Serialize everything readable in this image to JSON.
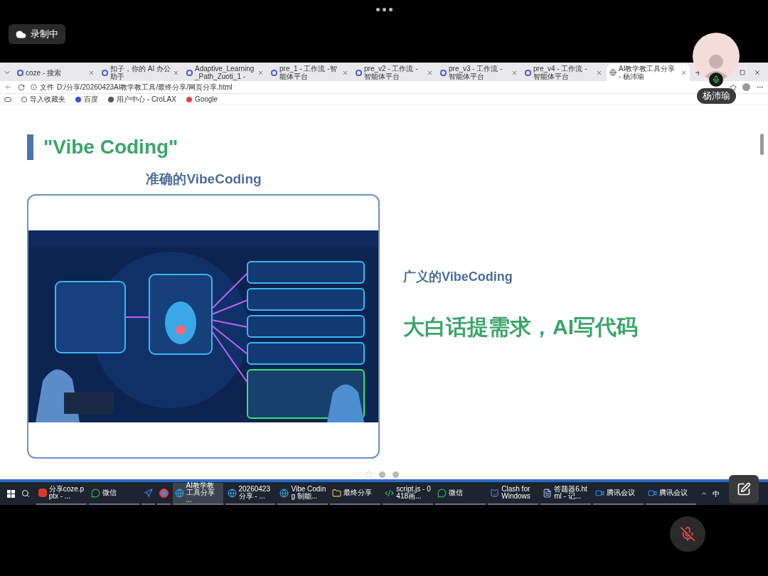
{
  "meeting": {
    "recording_label": "录制中",
    "speaker_name": "杨沛瑜",
    "speaker_mic_on": true,
    "self_muted": true
  },
  "browser": {
    "tabs": [
      {
        "label": "coze - 搜索",
        "selected": false
      },
      {
        "label": "扣子，你的 AI 办公助手",
        "selected": false
      },
      {
        "label": "Adaptive_Learning_Path_Zuoti_1 -",
        "selected": false
      },
      {
        "label": "pre_1 - 工作流 -智能体平台",
        "selected": false
      },
      {
        "label": "pre_v2 - 工作流 -智能体平台",
        "selected": false
      },
      {
        "label": "pre_v3 - 工作流 -智能体平台",
        "selected": false
      },
      {
        "label": "pre_v4 - 工作流 -智能体平台",
        "selected": false
      },
      {
        "label": "AI教学教工具分享 - 杨沛瑜",
        "selected": true
      }
    ],
    "address": {
      "scheme": "文件",
      "url": "D:/分享/20260423AI教学教工具/最终分享/网页分享.html"
    },
    "bookmarks": [
      "导入收藏夹",
      "百度",
      "用户中心 - CroLAX",
      "Google"
    ]
  },
  "slide": {
    "title": "\"Vibe Coding\"",
    "left_heading": "准确的VibeCoding",
    "right_heading": "广义的VibeCoding",
    "right_statement": "大白话提需求，AI写代码",
    "dots": [
      {
        "selected": true
      },
      {
        "selected": false
      },
      {
        "selected": false
      }
    ]
  },
  "taskbar": {
    "apps": [
      {
        "label": "分享coze.pptx - ...",
        "kind": "office",
        "active": false
      },
      {
        "label": "微信",
        "kind": "chat",
        "active": false
      },
      {
        "kind": "arrow",
        "active": false
      },
      {
        "kind": "chrome",
        "active": false
      },
      {
        "label": "AI教学教工具分享 ...",
        "kind": "edge",
        "active": true
      },
      {
        "label": "20260423分享 - ...",
        "kind": "edge",
        "active": false
      },
      {
        "label": "Vibe Coding 制能...",
        "kind": "edge",
        "active": false
      },
      {
        "label": "最终分享",
        "kind": "folder",
        "active": false
      },
      {
        "label": "script.js - 0418画...",
        "kind": "code",
        "active": false
      },
      {
        "label": "微信",
        "kind": "chat",
        "active": false
      },
      {
        "label": "Clash for Windows",
        "kind": "cat",
        "active": false
      },
      {
        "label": "答题器6.html - 记...",
        "kind": "notepad",
        "active": false
      },
      {
        "label": "腾讯会议",
        "kind": "meeting",
        "active": false
      },
      {
        "label": "腾讯会议",
        "kind": "meeting",
        "active": false
      }
    ],
    "input_method": "中"
  }
}
